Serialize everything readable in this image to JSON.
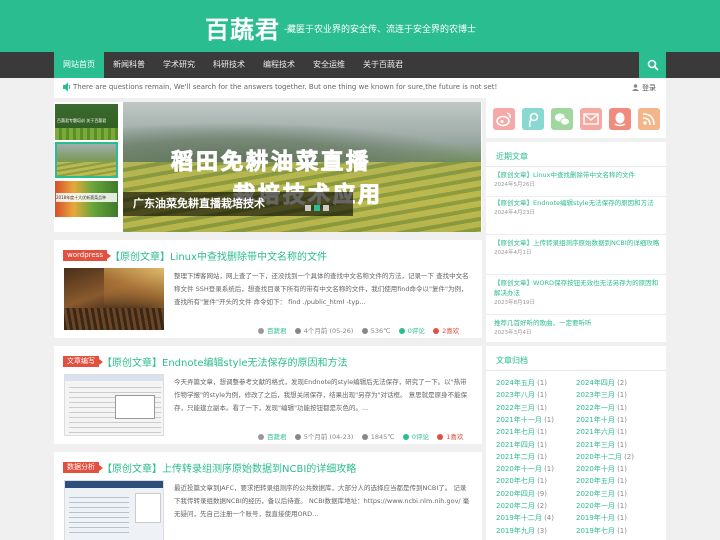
{
  "site": {
    "logo": "百蔬君",
    "slogan": "-藏匿于农业界的安全传、流连于安全界的农博士"
  },
  "nav": {
    "items": [
      "网站首页",
      "新闻科普",
      "学术研究",
      "科研技术",
      "编程技术",
      "安全运维",
      "关于百蔬君"
    ],
    "active_index": 0,
    "search_icon": "search-icon"
  },
  "notice": {
    "text": "There are questions remain, We'll search for the answers together. But one thing we known for sure,the future is not set!",
    "login_label": "登录"
  },
  "slider": {
    "title_line1": "稻田免耕油菜直播",
    "title_line2": "栽培技术应用",
    "caption": "广东油菜免耕直播栽培技术",
    "active_dot": 2,
    "dot_count": 3,
    "thumb_labels": [
      "百蔬君专题培训 关于百蔬君",
      "",
      "2018年度十大优新蔬菜品种"
    ]
  },
  "posts": [
    {
      "category": "wordpress",
      "title": "【原创文章】Linux中查找删除带中文名称的文件",
      "excerpt": "整理下博客网站，网上查了一下，还没找到一个具体的查找中文名称文件的方法，记录一下 查找中文名称文件 SSH登录系统后，想查找目录下所有的带有中文名称的文件，我们使用find命令以\"复件\"为例，查找所有\"复件\"开头的文件 命令如下： find ./public_html -typ...",
      "author": "百蔬君",
      "date": "4个月前 (05-26)",
      "views": "536℃",
      "comments": "0评论",
      "likes": "2喜欢"
    },
    {
      "category": "文章编写",
      "title": "【原创文章】Endnote编辑style无法保存的原因和方法",
      "excerpt": "今天弄篇文章，想调整参考文献的格式，发现Endnote的style编辑后无法保存，研究了一下。以\"热带作物学报\"的style为例，修改了之后，我想关闭保存，结果出现\"另存为\"对话框。 意思就是原身不能保存，只能建立副本。看了一下，发现\"编辑\"功能按钮都是灰色的。...",
      "author": "百蔬君",
      "date": "5个月前 (04-23)",
      "views": "1845℃",
      "comments": "0评论",
      "likes": "1喜欢"
    },
    {
      "category": "数据分析",
      "title": "【原创文章】上传转录组测序原始数据到NCBI的详细攻略",
      "excerpt": "最近投篇文章到JAFC，要求把转录组测序的公共数据库，大部分人的选择应当都是传到NCBI了。 记录下我传转录组数据NCBI的经历，备以后待查。 NCBI数据库地址：https://www.ncbi.nlm.nih.gov/ 毫无疑问，先自己注册一个账号，我直接使用ORD...",
      "author": "",
      "date": "",
      "views": "",
      "comments": "",
      "likes": ""
    }
  ],
  "social": [
    "weibo-icon",
    "tencent-weibo-icon",
    "wechat-icon",
    "email-icon",
    "qq-icon",
    "rss-icon"
  ],
  "recent": {
    "title": "近期文章",
    "items": [
      {
        "title": "【原创文章】Linux中查找删除带中文名称的文件",
        "date": "2024年5月26日"
      },
      {
        "title": "【原创文章】Endnote编辑style无法保存的原因和方法",
        "date": "2024年4月23日"
      },
      {
        "title": "【原创文章】上传转录组测序原始数据到NCBI的详细攻略",
        "date": "2024年4月1日"
      },
      {
        "title": "【原创文章】WORD保存按钮无效也无法另存为的原因和解决办法",
        "date": "2023年8月19日"
      },
      {
        "title": "推荐几首好听的歌曲，一定要听听",
        "date": "2023年3月4日"
      }
    ]
  },
  "archive": {
    "title": "文章归档",
    "items": [
      {
        "label": "2024年五月",
        "count": "(1)"
      },
      {
        "label": "2024年四月",
        "count": "(2)"
      },
      {
        "label": "2023年八月",
        "count": "(1)"
      },
      {
        "label": "2023年三月",
        "count": "(1)"
      },
      {
        "label": "2022年三月",
        "count": "(1)"
      },
      {
        "label": "2022年一月",
        "count": "(1)"
      },
      {
        "label": "2021年十一月",
        "count": "(1)"
      },
      {
        "label": "2021年十月",
        "count": "(1)"
      },
      {
        "label": "2021年七月",
        "count": "(1)"
      },
      {
        "label": "2021年六月",
        "count": "(1)"
      },
      {
        "label": "2021年四月",
        "count": "(1)"
      },
      {
        "label": "2021年三月",
        "count": "(1)"
      },
      {
        "label": "2021年二月",
        "count": "(1)"
      },
      {
        "label": "2020年十二月",
        "count": "(2)"
      },
      {
        "label": "2020年十一月",
        "count": "(1)"
      },
      {
        "label": "2020年十月",
        "count": "(1)"
      },
      {
        "label": "2020年七月",
        "count": "(1)"
      },
      {
        "label": "2020年五月",
        "count": "(1)"
      },
      {
        "label": "2020年四月",
        "count": "(9)"
      },
      {
        "label": "2020年三月",
        "count": "(1)"
      },
      {
        "label": "2020年二月",
        "count": "(2)"
      },
      {
        "label": "2020年一月",
        "count": "(1)"
      },
      {
        "label": "2019年十二月",
        "count": "(4)"
      },
      {
        "label": "2019年十月",
        "count": "(1)"
      },
      {
        "label": "2019年九月",
        "count": "(3)"
      },
      {
        "label": "2019年七月",
        "count": "(1)"
      }
    ]
  },
  "colors": {
    "accent": "#2abd8f",
    "nav_bg": "#3a3a3a",
    "category_red": "#e2513f"
  }
}
